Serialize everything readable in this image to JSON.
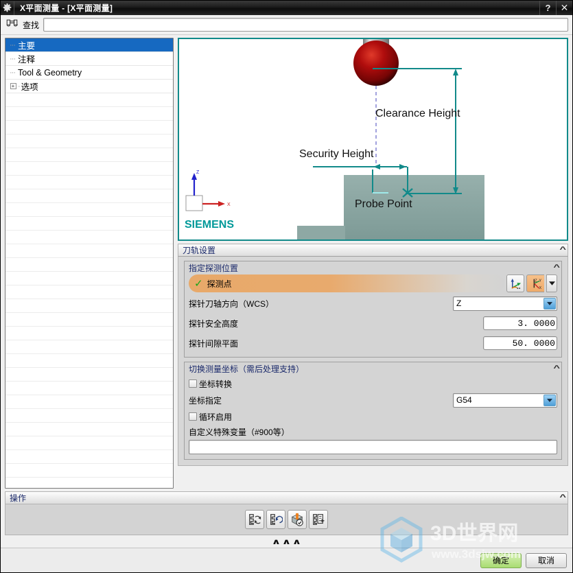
{
  "window": {
    "title": "X平面测量 - [X平面测量]",
    "app_icon": "gear-icon",
    "help_button": "?",
    "close_button": "✕"
  },
  "find": {
    "icon": "binoculars-icon",
    "label": "查找",
    "value": "",
    "placeholder": ""
  },
  "tree": {
    "items": [
      {
        "label": "主要",
        "selected": true,
        "expandable": false
      },
      {
        "label": "注释",
        "selected": false,
        "expandable": false
      },
      {
        "label": "Tool & Geometry",
        "selected": false,
        "expandable": false
      },
      {
        "label": "选项",
        "selected": false,
        "expandable": true,
        "expander": "+"
      }
    ]
  },
  "graphic": {
    "labels": {
      "clearance_height": "Clearance Height",
      "security_height": "Security Height",
      "probe_point": "Probe Point",
      "brand": "SIEMENS",
      "axis_z": "Z",
      "axis_x": "X"
    },
    "colors": {
      "accent": "#118a8a",
      "part": "#8aa8a4",
      "probe_ball": "#a80b0b",
      "brand": "#009999",
      "dash": "#7a7ad0"
    }
  },
  "toolpath_group": {
    "title": "刀轨设置",
    "collapse_icon": "chevron-up-icon"
  },
  "probe_position_group": {
    "title": "指定探测位置",
    "collapse_icon": "chevron-up-icon",
    "selection": {
      "status_icon": "check-icon",
      "label": "探测点",
      "point_button_icon": "specify-point-icon",
      "csys_button_icon": "csys-icon",
      "csys_dropdown_icon": "chevron-down-icon"
    },
    "fields": [
      {
        "label": "探针刀轴方向（WCS）",
        "type": "combo",
        "value": "Z",
        "dropdown_icon": "chevron-down-icon"
      },
      {
        "label": "探针安全高度",
        "type": "number",
        "value": "3. 0000"
      },
      {
        "label": "探针间隙平面",
        "type": "number",
        "value": "50. 0000"
      }
    ]
  },
  "coord_group": {
    "title": "切换测量坐标（需后处理支持）",
    "collapse_icon": "chevron-up-icon",
    "checkbox_transform": {
      "label": "坐标转换",
      "checked": false
    },
    "combo_row": {
      "label": "坐标指定",
      "value": "G54",
      "dropdown_icon": "chevron-down-icon"
    },
    "checkbox_cycle": {
      "label": "循环启用",
      "checked": false
    },
    "custom_var": {
      "label": "自定义特殊变量（#900等）",
      "value": "",
      "placeholder": ""
    }
  },
  "operations": {
    "title": "操作",
    "collapse_icon": "chevron-up-icon",
    "buttons": [
      {
        "name": "generate-toolpath-button",
        "icon": "generate-icon"
      },
      {
        "name": "replay-toolpath-button",
        "icon": "replay-icon"
      },
      {
        "name": "verify-toolpath-button",
        "icon": "verify-icon"
      },
      {
        "name": "list-toolpath-button",
        "icon": "list-icon"
      }
    ],
    "collapse_arrows": [
      "∧",
      "∧",
      "∧"
    ]
  },
  "footer": {
    "ok_label": "确定",
    "cancel_label": "取消"
  },
  "watermark": {
    "text": "3D世界网",
    "url": "www.3dsjw.com"
  }
}
